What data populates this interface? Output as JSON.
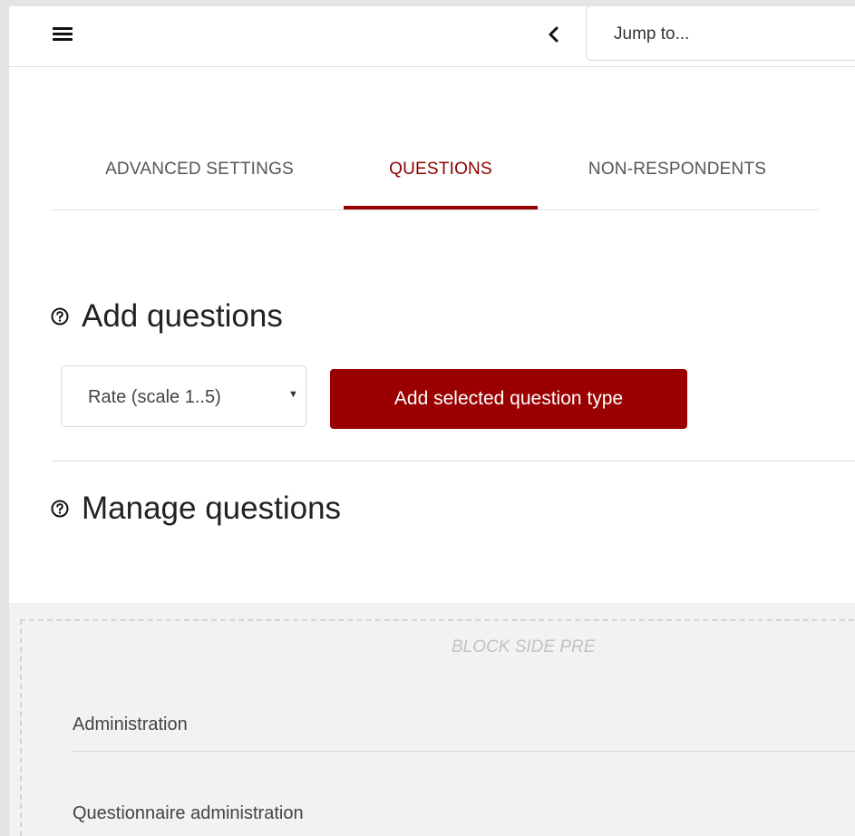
{
  "header": {
    "menu_icon": "hamburger-menu-icon",
    "collapse_icon": "chevron-left-icon",
    "jump_placeholder": "Jump to..."
  },
  "tabs": [
    {
      "label": "ADVANCED SETTINGS",
      "active": false
    },
    {
      "label": "QUESTIONS",
      "active": true
    },
    {
      "label": "NON-RESPONDENTS",
      "active": false
    }
  ],
  "add_section": {
    "title": "Add questions",
    "help_icon": "question-circle-icon",
    "select_value": "Rate (scale 1..5)",
    "button_label": "Add selected question type"
  },
  "manage_section": {
    "title": "Manage questions",
    "help_icon": "question-circle-icon"
  },
  "block": {
    "label": "BLOCK SIDE PRE",
    "heading": "Administration",
    "items": [
      "Questionnaire administration"
    ]
  },
  "colors": {
    "accent": "#9a0000",
    "active_tab_text": "#8b0000"
  }
}
